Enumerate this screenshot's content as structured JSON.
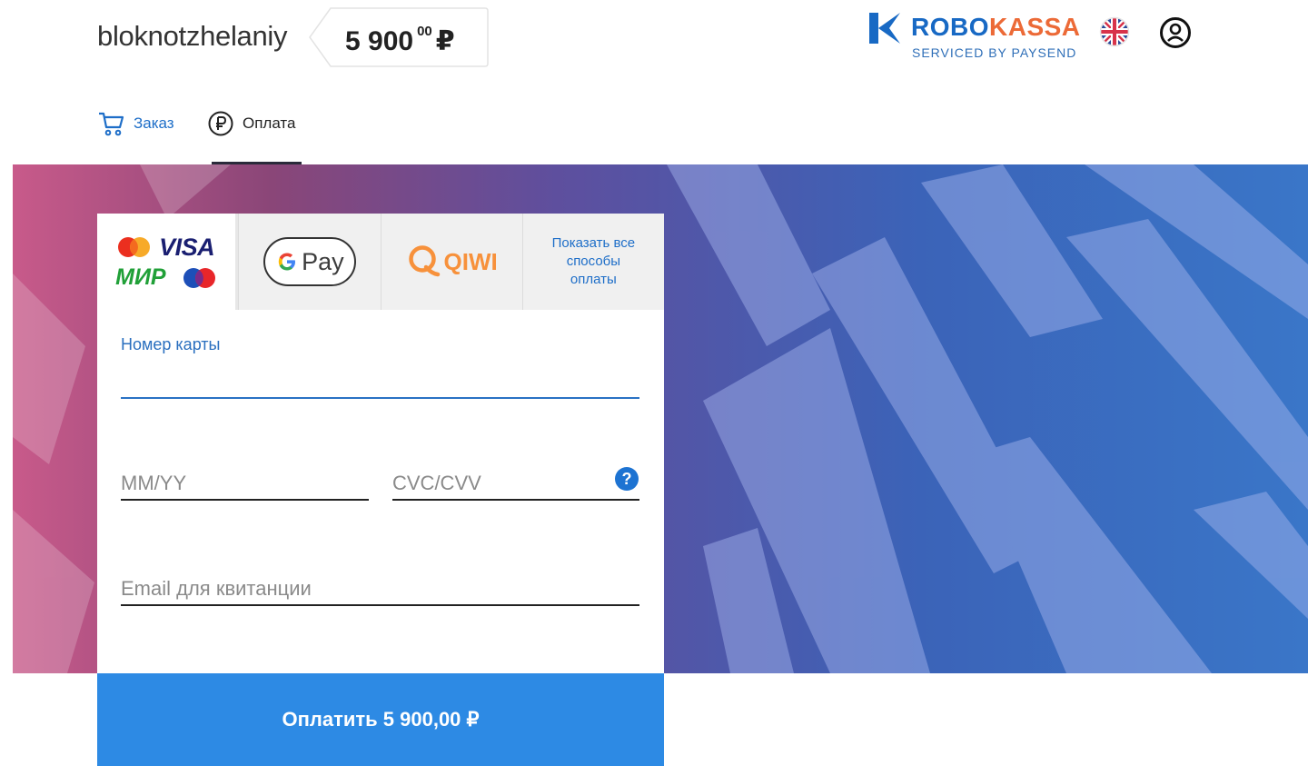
{
  "header": {
    "shop_name": "bloknotzhelaniy",
    "amount": {
      "main": "5 900",
      "cents": "00",
      "currency": "₽"
    },
    "logo": {
      "word_part1": "ROBO",
      "word_part2": "KASSA",
      "subtitle": "SERVICED BY PAYSEND"
    },
    "icons": {
      "language": "uk-flag-icon",
      "user": "user-icon"
    }
  },
  "tabs": [
    {
      "label": "Заказ",
      "icon": "cart-icon",
      "active": false
    },
    {
      "label": "Оплата",
      "icon": "ruble-icon",
      "active": true
    }
  ],
  "payment_methods": {
    "cards": {
      "visa_label": "VISA",
      "mir_label": "МИР"
    },
    "gpay_label": "Pay",
    "qiwi_label": "QIWI",
    "show_all_label": "Показать все способы оплаты"
  },
  "form": {
    "card_number_label": "Номер карты",
    "card_number_value": "",
    "expiry_placeholder": "MM/YY",
    "cvc_placeholder": "CVC/CVV",
    "help_label": "?",
    "email_placeholder": "Email для квитанции"
  },
  "pay_button_label": "Оплатить 5 900,00 ₽",
  "colors": {
    "accent_blue": "#2d8ae4",
    "link_blue": "#1e6ec8",
    "kassa_orange": "#ec6a37",
    "qiwi_orange": "#f7913b"
  }
}
